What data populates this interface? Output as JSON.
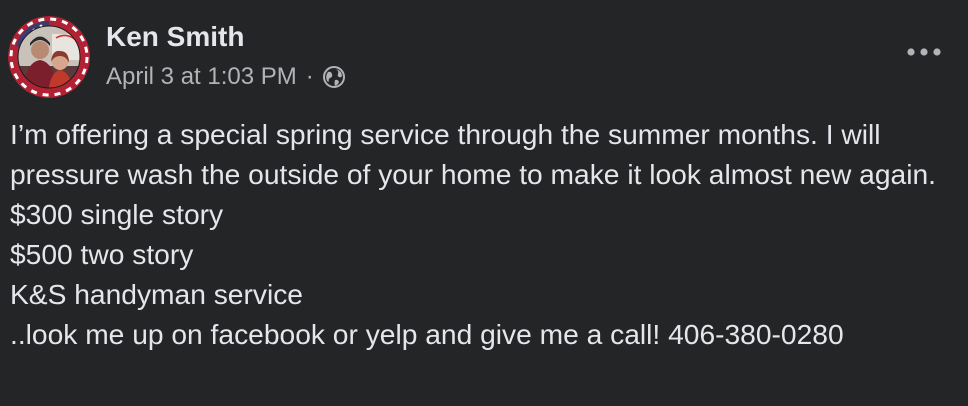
{
  "post": {
    "author": "Ken Smith",
    "timestamp": "April 3 at 1:03 PM",
    "separator": "·",
    "audience_icon": "globe-icon",
    "more_icon": "more-options-icon",
    "text": "I’m offering a special spring service through the summer months. I will pressure wash the outside of your home to make it look almost new again.\n$300 single story\n$500 two story\nK&S handyman service\n..look me up on facebook or yelp and give me a call! 406-380-0280"
  },
  "colors": {
    "background": "#242526",
    "primary_text": "#e4e6eb",
    "secondary_text": "#b0b3b8",
    "avatar_flag_red": "#b22234",
    "avatar_flag_blue": "#3c3b6e"
  }
}
